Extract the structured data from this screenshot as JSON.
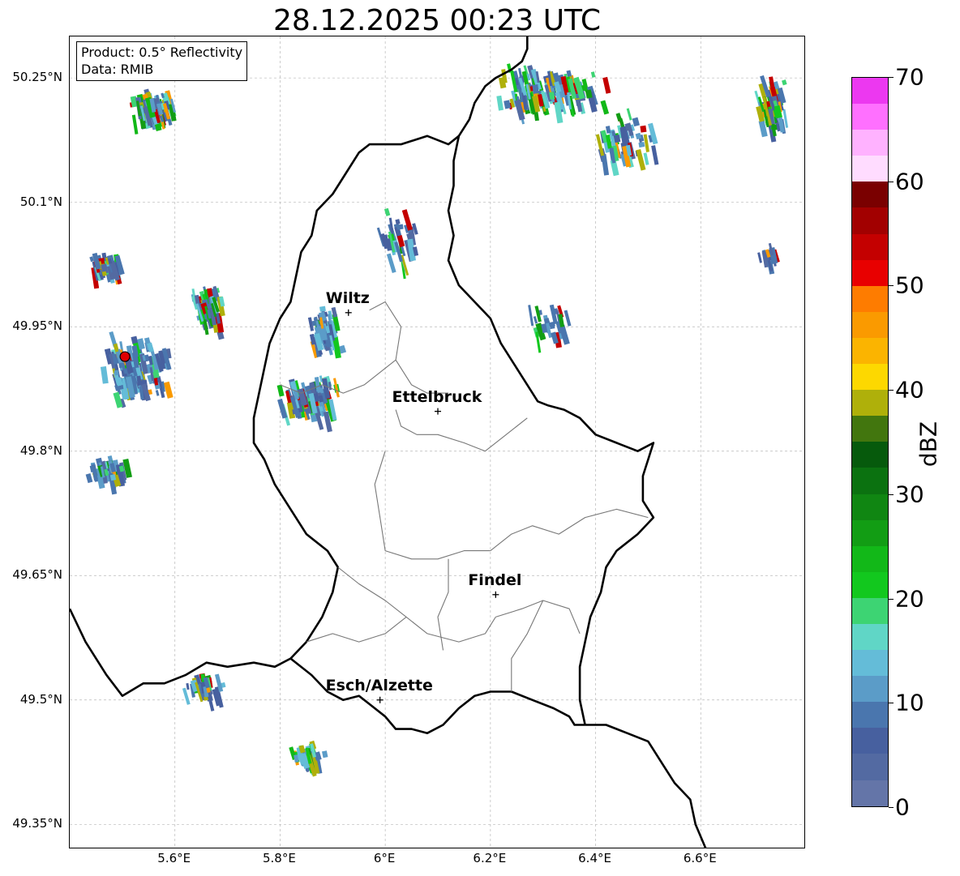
{
  "title": "28.12.2025 00:23 UTC",
  "info": {
    "product": "Product: 0.5° Reflectivity",
    "data": "Data: RMIB"
  },
  "axes": {
    "lon_range": [
      5.4,
      6.8
    ],
    "lat_range": [
      49.32,
      50.3
    ],
    "x_ticks": [
      {
        "value": 5.6,
        "label": "5.6°E"
      },
      {
        "value": 5.8,
        "label": "5.8°E"
      },
      {
        "value": 6.0,
        "label": "6°E"
      },
      {
        "value": 6.2,
        "label": "6.2°E"
      },
      {
        "value": 6.4,
        "label": "6.4°E"
      },
      {
        "value": 6.6,
        "label": "6.6°E"
      }
    ],
    "y_ticks": [
      {
        "value": 50.25,
        "label": "50.25°N"
      },
      {
        "value": 50.1,
        "label": "50.1°N"
      },
      {
        "value": 49.95,
        "label": "49.95°N"
      },
      {
        "value": 49.8,
        "label": "49.8°N"
      },
      {
        "value": 49.65,
        "label": "49.65°N"
      },
      {
        "value": 49.5,
        "label": "49.5°N"
      },
      {
        "value": 49.35,
        "label": "49.35°N"
      }
    ],
    "grid": true
  },
  "cities": [
    {
      "name": "Wiltz",
      "lon": 5.93,
      "lat": 49.967
    },
    {
      "name": "Ettelbruck",
      "lon": 6.1,
      "lat": 49.848
    },
    {
      "name": "Findel",
      "lon": 6.21,
      "lat": 49.627
    },
    {
      "name": "Esch/Alzette",
      "lon": 5.99,
      "lat": 49.5
    }
  ],
  "radar_site": {
    "lon": 5.505,
    "lat": 49.914,
    "color": "#e00000"
  },
  "colorbar": {
    "label": "dBZ",
    "min": 0,
    "max": 70,
    "ticks": [
      {
        "value": 0,
        "label": "0"
      },
      {
        "value": 10,
        "label": "10"
      },
      {
        "value": 20,
        "label": "20"
      },
      {
        "value": 30,
        "label": "30"
      },
      {
        "value": 40,
        "label": "40"
      },
      {
        "value": 50,
        "label": "50"
      },
      {
        "value": 60,
        "label": "60"
      },
      {
        "value": 70,
        "label": "70"
      }
    ],
    "colors": [
      "#6475a8",
      "#536aa2",
      "#47609f",
      "#4a76ae",
      "#5b9cc8",
      "#64bcd8",
      "#60d6c6",
      "#3dd473",
      "#12c81e",
      "#12b818",
      "#129d14",
      "#108612",
      "#0b7210",
      "#065a0c",
      "#42760e",
      "#afb00a",
      "#fdd800",
      "#fbb400",
      "#fa9a00",
      "#fe7c00",
      "#e80000",
      "#c40000",
      "#a20000",
      "#7a0000",
      "#ffdcff",
      "#ffb2ff",
      "#ff70ff",
      "#ec38f0"
    ]
  },
  "echo_clusters": [
    {
      "lon": 5.55,
      "lat": 50.22,
      "n": 90,
      "sx": 0.06,
      "sy": 0.02,
      "rot": -0.25,
      "mix": 0.35
    },
    {
      "lon": 5.46,
      "lat": 50.03,
      "n": 40,
      "sx": 0.04,
      "sy": 0.02,
      "rot": 0,
      "mix": 0.3
    },
    {
      "lon": 5.66,
      "lat": 49.98,
      "n": 60,
      "sx": 0.04,
      "sy": 0.03,
      "rot": 0,
      "mix": 0.4
    },
    {
      "lon": 5.52,
      "lat": 49.9,
      "n": 120,
      "sx": 0.09,
      "sy": 0.05,
      "rot": 0,
      "mix": 0.2
    },
    {
      "lon": 5.47,
      "lat": 49.78,
      "n": 40,
      "sx": 0.05,
      "sy": 0.02,
      "rot": 0,
      "mix": 0.25
    },
    {
      "lon": 5.85,
      "lat": 49.87,
      "n": 110,
      "sx": 0.07,
      "sy": 0.03,
      "rot": 0.4,
      "mix": 0.3
    },
    {
      "lon": 5.88,
      "lat": 49.95,
      "n": 60,
      "sx": 0.05,
      "sy": 0.03,
      "rot": 0,
      "mix": 0.2
    },
    {
      "lon": 6.02,
      "lat": 50.06,
      "n": 35,
      "sx": 0.05,
      "sy": 0.04,
      "rot": 0,
      "mix": 0.3
    },
    {
      "lon": 5.65,
      "lat": 49.52,
      "n": 30,
      "sx": 0.05,
      "sy": 0.015,
      "rot": 0,
      "mix": 0.3
    },
    {
      "lon": 5.85,
      "lat": 49.44,
      "n": 40,
      "sx": 0.04,
      "sy": 0.015,
      "rot": -0.5,
      "mix": 0.5
    },
    {
      "lon": 6.3,
      "lat": 50.24,
      "n": 130,
      "sx": 0.12,
      "sy": 0.04,
      "rot": 0,
      "mix": 0.5
    },
    {
      "lon": 6.45,
      "lat": 50.18,
      "n": 60,
      "sx": 0.07,
      "sy": 0.04,
      "rot": 0,
      "mix": 0.3
    },
    {
      "lon": 6.73,
      "lat": 50.22,
      "n": 60,
      "sx": 0.04,
      "sy": 0.05,
      "rot": 0,
      "mix": 0.6
    },
    {
      "lon": 6.3,
      "lat": 49.96,
      "n": 25,
      "sx": 0.06,
      "sy": 0.03,
      "rot": 0,
      "mix": 0.3
    },
    {
      "lon": 6.73,
      "lat": 50.04,
      "n": 12,
      "sx": 0.03,
      "sy": 0.02,
      "rot": 0,
      "mix": 0.2
    }
  ]
}
